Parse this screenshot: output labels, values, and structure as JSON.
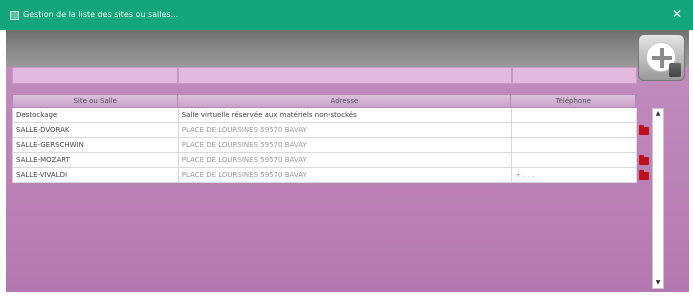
{
  "window": {
    "title": "Gestion de la liste des sites ou salles...",
    "close_glyph": "✕"
  },
  "add_button": {
    "icon": "plus-icon"
  },
  "filters": [
    "",
    "",
    ""
  ],
  "table": {
    "columns": [
      "Site ou Salle",
      "Adresse",
      "Téléphone"
    ],
    "rows": [
      {
        "site": "Destockage",
        "adresse": "Salle virtuelle réservée aux matériels non-stockés",
        "telephone": "",
        "folder": false
      },
      {
        "site": "SALLE-DVORAK",
        "adresse": "PLACE DE LOURSINES 59570 BAVAY",
        "telephone": "",
        "folder": true
      },
      {
        "site": "SALLE-GERSCHWIN",
        "adresse": "PLACE DE LOURSINES 59570 BAVAY",
        "telephone": "",
        "folder": false
      },
      {
        "site": "SALLE-MOZART",
        "adresse": "PLACE DE LOURSINES 59570 BAVAY",
        "telephone": "",
        "folder": true
      },
      {
        "site": "SALLE-VIVALDI",
        "adresse": "PLACE DE LOURSINES 59570 BAVAY",
        "telephone": "+ . . .",
        "folder": true
      }
    ]
  },
  "scrollbar": {
    "up_glyph": "▲",
    "down_glyph": "▼"
  },
  "colors": {
    "titlebar": "#13a67c",
    "panel": "#b97fb4",
    "filter": "#e3b9e0",
    "folder": "#c0101a"
  }
}
